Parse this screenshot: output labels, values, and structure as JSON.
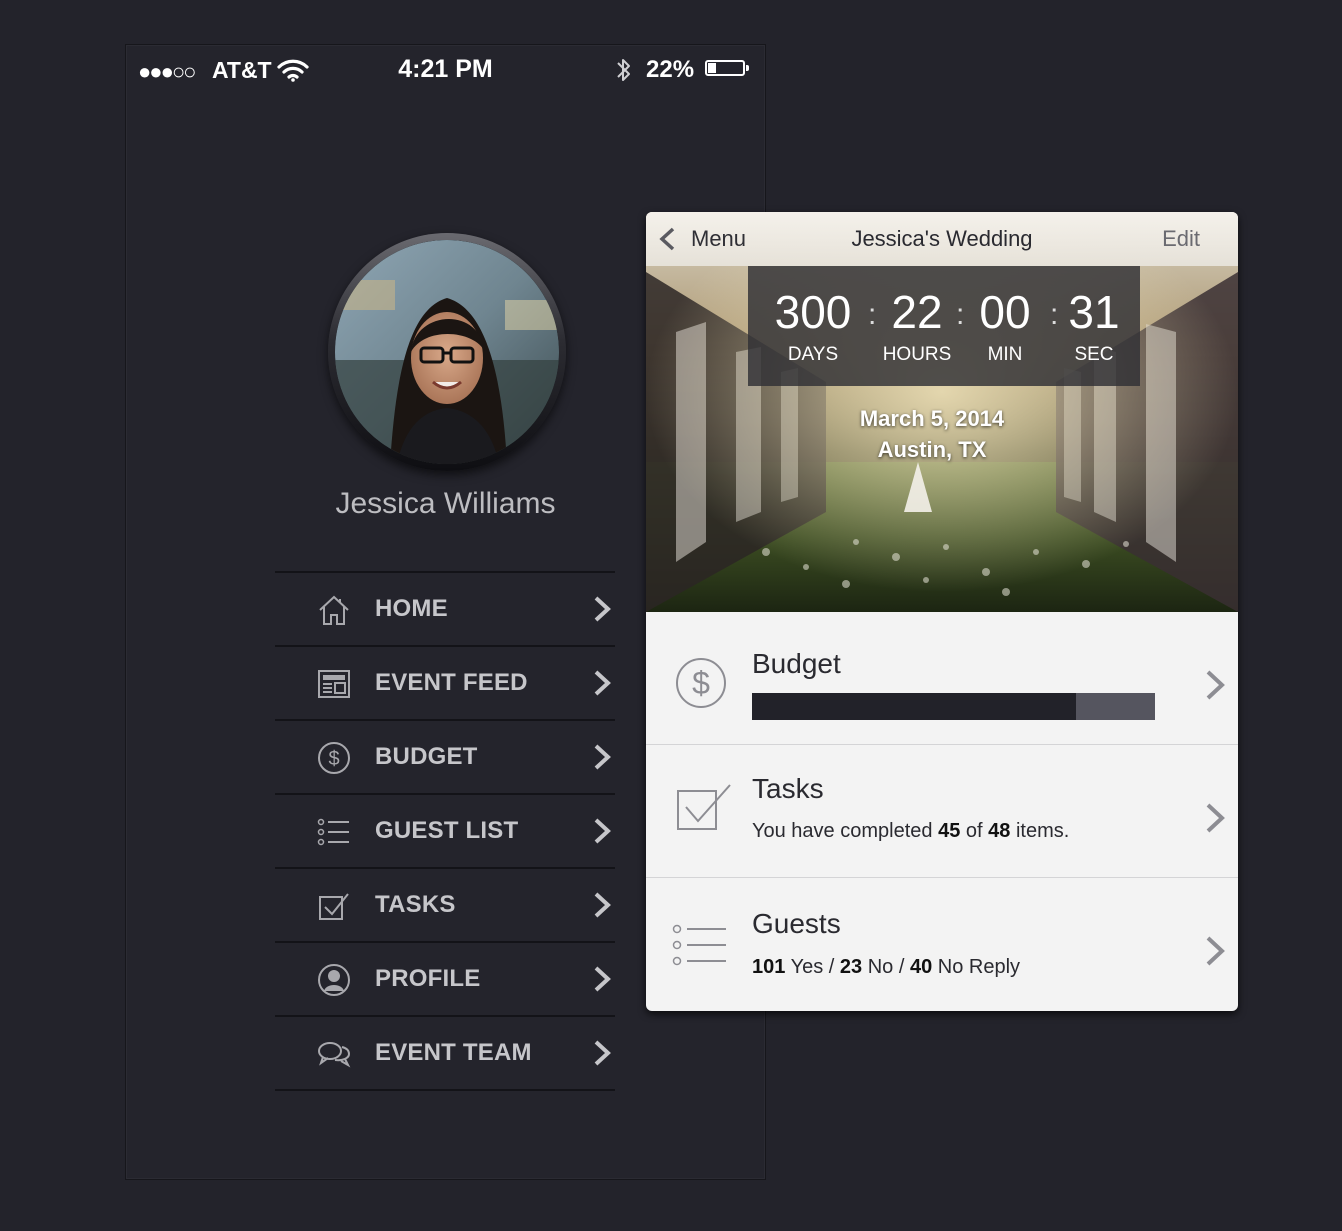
{
  "status_bar": {
    "signal": "●●●○○",
    "carrier": "AT&T",
    "time": "4:21 PM",
    "battery_pct": "22%",
    "battery_level": 0.22
  },
  "profile": {
    "name": "Jessica Williams"
  },
  "menu": {
    "items": [
      {
        "label": "HOME",
        "icon": "home-icon"
      },
      {
        "label": "EVENT FEED",
        "icon": "newspaper-icon"
      },
      {
        "label": "BUDGET",
        "icon": "dollar-icon"
      },
      {
        "label": "GUEST LIST",
        "icon": "list-icon"
      },
      {
        "label": "TASKS",
        "icon": "checkbox-icon"
      },
      {
        "label": "PROFILE",
        "icon": "user-icon"
      },
      {
        "label": "EVENT TEAM",
        "icon": "chat-icon"
      }
    ]
  },
  "event": {
    "nav": {
      "back_label": "Menu",
      "title": "Jessica's Wedding",
      "edit_label": "Edit"
    },
    "countdown": {
      "days": "300",
      "days_label": "DAYS",
      "hours": "22",
      "hours_label": "HOURS",
      "min": "00",
      "min_label": "MIN",
      "sec": "31",
      "sec_label": "SEC",
      "separator": ":"
    },
    "date": "March 5, 2014",
    "location": "Austin, TX"
  },
  "summary": {
    "budget": {
      "title": "Budget",
      "spent_fraction": 0.805
    },
    "tasks": {
      "title": "Tasks",
      "prefix": "You have completed",
      "completed": "45",
      "of": "of",
      "total": "48",
      "suffix": "items."
    },
    "guests": {
      "title": "Guests",
      "yes": "101",
      "yes_label": "Yes",
      "no": "23",
      "no_label": "No",
      "no_reply": "40",
      "no_reply_label": "No Reply",
      "sep": "/"
    }
  },
  "colors": {
    "background": "#23232b",
    "menu_text": "#c6c6ca",
    "budget_fill": "#222229",
    "budget_track": "#55555f",
    "card_bg": "#f3f3f3"
  }
}
